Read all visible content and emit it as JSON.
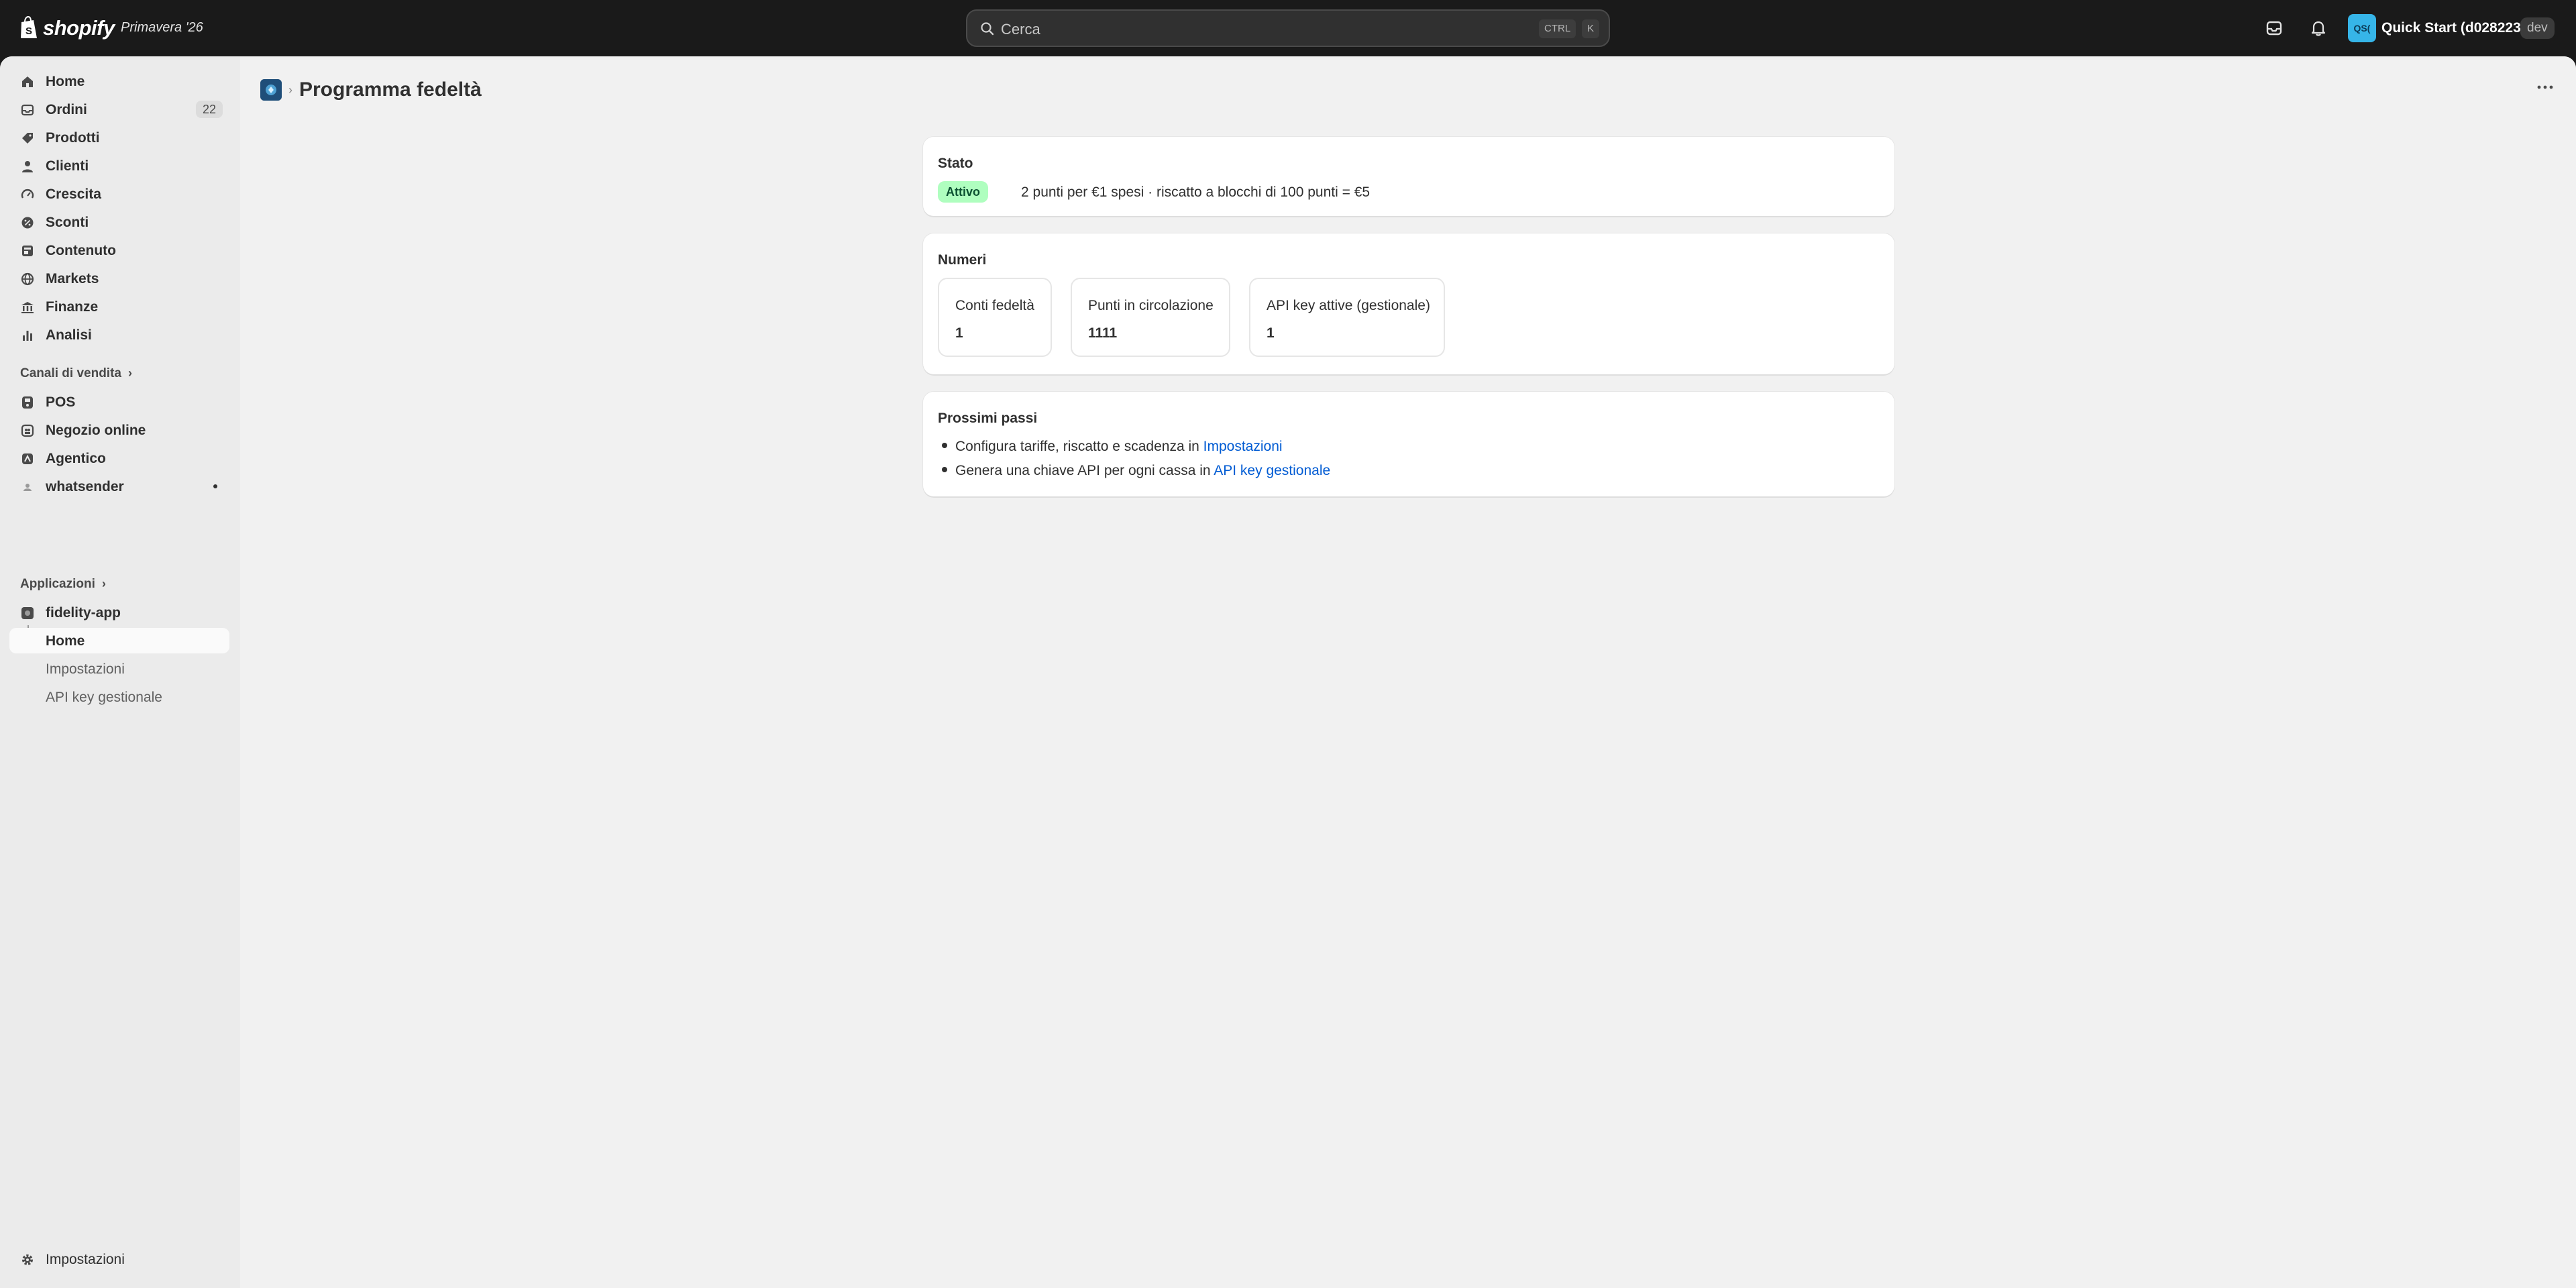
{
  "topbar": {
    "logo_text": "shopify",
    "edition": "Primavera '26",
    "search_placeholder": "Cerca",
    "shortcut_ctrl": "CTRL",
    "shortcut_key": "K",
    "store_initials": "QS(",
    "store_name": "Quick Start (d0282239)",
    "env_tag": "dev"
  },
  "sidebar": {
    "items": [
      {
        "label": "Home",
        "icon": "home-icon"
      },
      {
        "label": "Ordini",
        "icon": "inbox-icon",
        "count": "22"
      },
      {
        "label": "Prodotti",
        "icon": "tag-icon"
      },
      {
        "label": "Clienti",
        "icon": "person-icon"
      },
      {
        "label": "Crescita",
        "icon": "gauge-icon"
      },
      {
        "label": "Sconti",
        "icon": "discount-icon"
      },
      {
        "label": "Contenuto",
        "icon": "content-icon"
      },
      {
        "label": "Markets",
        "icon": "globe-icon"
      },
      {
        "label": "Finanze",
        "icon": "bank-icon"
      },
      {
        "label": "Analisi",
        "icon": "bar-chart-icon"
      }
    ],
    "sales_channels_title": "Canali di vendita",
    "sales_channels": [
      {
        "label": "POS",
        "icon": "pos-icon"
      },
      {
        "label": "Negozio online",
        "icon": "store-icon"
      },
      {
        "label": "Agentico",
        "icon": "agent-icon"
      },
      {
        "label": "whatsender",
        "icon": "whatsender-icon"
      }
    ],
    "apps_title": "Applicazioni",
    "app": {
      "label": "fidelity-app",
      "icon": "fidelity-app-icon"
    },
    "app_subitems": [
      {
        "label": "Home"
      },
      {
        "label": "Impostazioni"
      },
      {
        "label": "API key gestionale"
      }
    ],
    "settings_label": "Impostazioni"
  },
  "page": {
    "title": "Programma fedeltà",
    "status_card": {
      "title": "Stato",
      "badge": "Attivo",
      "text": "2 punti per €1 spesi · riscatto a blocchi di 100 punti = €5"
    },
    "numbers_card": {
      "title": "Numeri",
      "metrics": [
        {
          "label": "Conti fedeltà",
          "value": "1"
        },
        {
          "label": "Punti in circolazione",
          "value": "1111"
        },
        {
          "label": "API key attive (gestionale)",
          "value": "1"
        }
      ]
    },
    "next_steps_card": {
      "title": "Prossimi passi",
      "steps": [
        {
          "text": "Configura tariffe, riscatto e scadenza in ",
          "link": "Impostazioni"
        },
        {
          "text": "Genera una chiave API per ogni cassa in ",
          "link": "API key gestionale"
        }
      ]
    }
  },
  "colors": {
    "topbar_bg": "#1a1a1a",
    "badge_success_bg": "#affebf",
    "badge_success_text": "#0c5132",
    "link": "#005bd3"
  }
}
